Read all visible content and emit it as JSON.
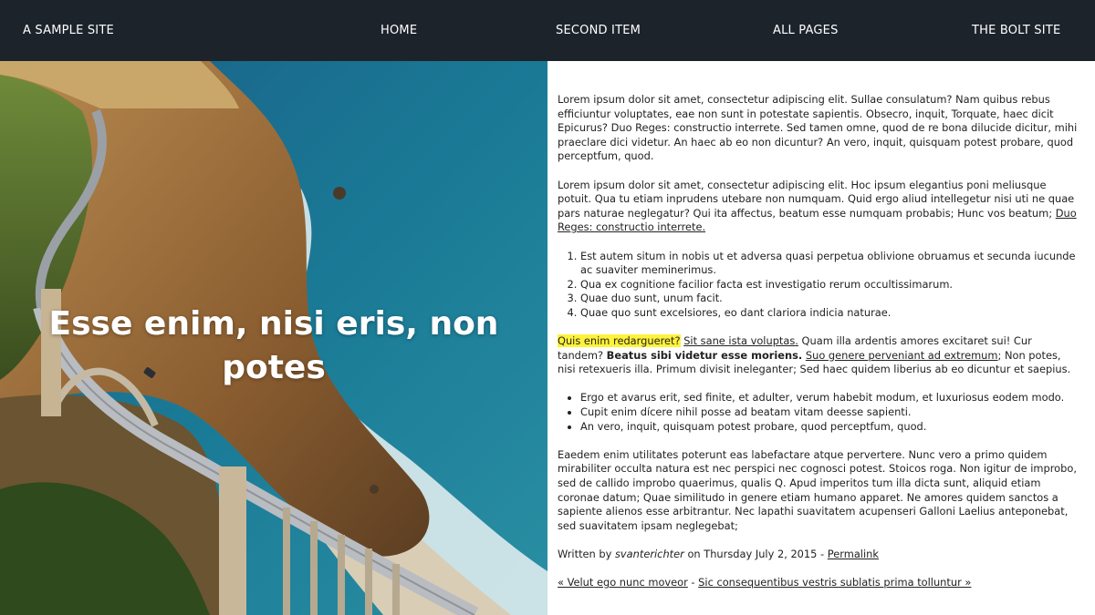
{
  "nav": {
    "site_title": "A SAMPLE SITE",
    "items": [
      "HOME",
      "SECOND ITEM",
      "ALL PAGES",
      "THE BOLT SITE"
    ]
  },
  "hero": {
    "title_line1": "Esse enim, nisi eris, non",
    "title_line2": "potes"
  },
  "article": {
    "p1": "Lorem ipsum dolor sit amet, consectetur adipiscing elit. Sullae consulatum? Nam quibus rebus efficiuntur voluptates, eae non sunt in potestate sapientis. Obsecro, inquit, Torquate, haec dicit Epicurus? Duo Reges: constructio interrete. Sed tamen omne, quod de re bona dilucide dicitur, mihi praeclare dici videtur. An haec ab eo non dicuntur? An vero, inquit, quisquam potest probare, quod perceptfum, quod.",
    "p2_text": "Lorem ipsum dolor sit amet, consectetur adipiscing elit. Hoc ipsum elegantius poni meliusque potuit. Qua tu etiam inprudens utebare non numquam. Quid ergo aliud intellegetur nisi uti ne quae pars naturae neglegatur? Qui ita affectus, beatum esse numquam probabis; Hunc vos beatum; ",
    "p2_link": "Duo Reges: constructio interrete.",
    "ol": [
      "Est autem situm in nobis ut et adversa quasi perpetua oblivione obruamus et secunda iucunde ac suaviter meminerimus.",
      "Qua ex cognitione facilior facta est investigatio rerum occultissimarum.",
      "Quae duo sunt, unum facit.",
      "Quae quo sunt excelsiores, eo dant clariora indicia naturae."
    ],
    "p3_highlight": "Quis enim redargueret?",
    "p3_link1": "Sit sane ista voluptas.",
    "p3_text1": " Quam illa ardentis amores excitaret sui! Cur tandem? ",
    "p3_bold": "Beatus sibi videtur esse moriens.",
    "p3_link2": "Suo genere perveniant ad extremum",
    "p3_text2": "; Non potes, nisi retexueris illa. Primum divisit ineleganter; Sed haec quidem liberius ab eo dicuntur et saepius.",
    "ul": [
      "Ergo et avarus erit, sed finite, et adulter, verum habebit modum, et luxuriosus eodem modo.",
      "Cupit enim dícere nihil posse ad beatam vitam deesse sapienti.",
      "An vero, inquit, quisquam potest probare, quod perceptfum, quod."
    ],
    "p4": "Eaedem enim utilitates poterunt eas labefactare atque pervertere. Nunc vero a primo quidem mirabiliter occulta natura est nec perspici nec cognosci potest. Stoicos roga. Non igitur de improbo, sed de callido improbo quaerimus, qualis Q. Apud imperitos tum illa dicta sunt, aliquid etiam coronae datum; Quae similitudo in genere etiam humano apparet. Ne amores quidem sanctos a sapiente alienos esse arbitrantur. Nec lapathi suavitatem acupenseri Galloni Laelius anteponebat, sed suavitatem ipsam neglegebat;",
    "meta_prefix": "Written by ",
    "meta_author": "svanterichter",
    "meta_mid": " on Thursday July 2, 2015 - ",
    "meta_permalink": "Permalink",
    "prev_link": "« Velut ego nunc moveor",
    "sep": " - ",
    "next_link": "Sic consequentibus vestris sublatis prima tolluntur »"
  },
  "colors": {
    "nav_bg": "#1d232b",
    "highlight": "#fff23a",
    "ocean": "#1f6f8b",
    "cliff": "#a8773e"
  }
}
